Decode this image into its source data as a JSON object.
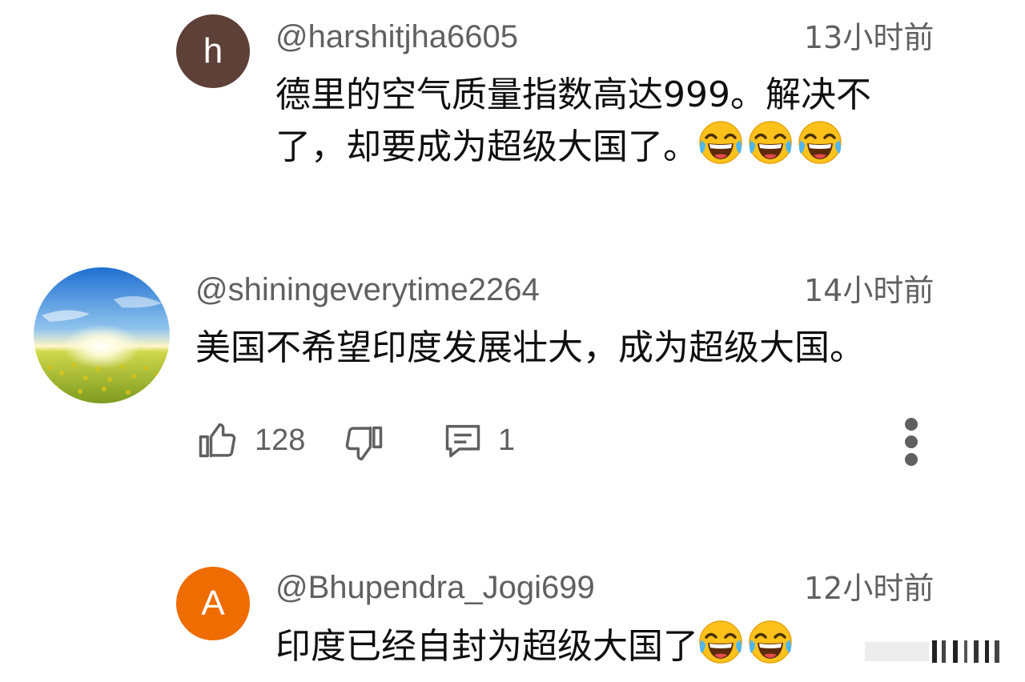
{
  "comments": [
    {
      "avatar_letter": "h",
      "avatar_color": "#5d4037",
      "handle": "@harshitjha6605",
      "time": "13小时前",
      "line1": "德里的空气质量指数高达999。解决不",
      "line2": "了，却要成为超级大国了。",
      "emojis": [
        "tears-of-joy-emoji",
        "tears-of-joy-emoji",
        "tears-of-joy-emoji"
      ]
    },
    {
      "avatar_letter": "",
      "avatar_image": "sunrise-over-flower-field",
      "handle": "@shiningeverytime2264",
      "time": "14小时前",
      "line1": "美国不希望印度发展壮大，成为超级大国。",
      "actions": {
        "like_count": "128",
        "reply_count": "1",
        "like_icon": "thumbs-up-icon",
        "dislike_icon": "thumbs-down-icon",
        "reply_icon": "comment-icon",
        "more_icon": "more-vertical-icon"
      }
    },
    {
      "avatar_letter": "A",
      "avatar_color": "#ef6c00",
      "handle": "@Bhupendra_Jogi699",
      "time": "12小时前",
      "line1": "印度已经自封为超级大国了",
      "emojis": [
        "tears-of-joy-emoji",
        "tears-of-joy-emoji"
      ]
    }
  ],
  "colors": {
    "secondary_text": "#606060",
    "primary_text": "#0f0f0f",
    "background": "#ffffff"
  }
}
